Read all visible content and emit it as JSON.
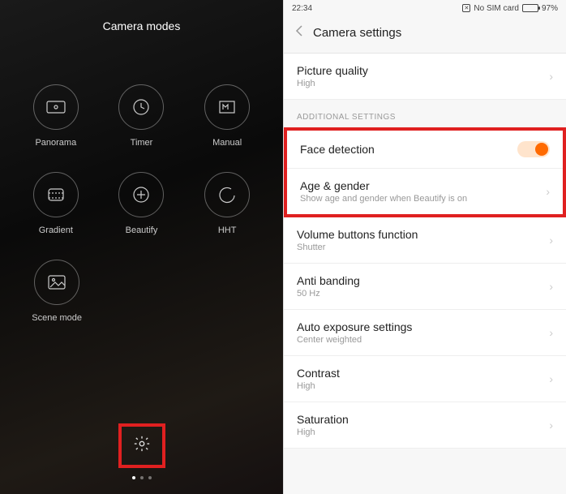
{
  "left": {
    "title": "Camera modes",
    "modes": [
      {
        "label": "Panorama",
        "icon": "panorama"
      },
      {
        "label": "Timer",
        "icon": "timer"
      },
      {
        "label": "Manual",
        "icon": "manual"
      },
      {
        "label": "Gradient",
        "icon": "gradient"
      },
      {
        "label": "Beautify",
        "icon": "beautify"
      },
      {
        "label": "HHT",
        "icon": "hht"
      },
      {
        "label": "Scene mode",
        "icon": "scene"
      }
    ]
  },
  "right": {
    "status": {
      "time": "22:34",
      "sim": "No SIM card",
      "battery_pct": "97%"
    },
    "header": "Camera settings",
    "top_rows": [
      {
        "title": "Picture quality",
        "sub": "High"
      }
    ],
    "section_label": "ADDITIONAL SETTINGS",
    "highlighted": [
      {
        "title": "Face detection",
        "toggle": true
      },
      {
        "title": "Age & gender",
        "sub": "Show age and gender when Beautify is on"
      }
    ],
    "rows": [
      {
        "title": "Volume buttons function",
        "sub": "Shutter"
      },
      {
        "title": "Anti banding",
        "sub": "50 Hz"
      },
      {
        "title": "Auto exposure settings",
        "sub": "Center weighted"
      },
      {
        "title": "Contrast",
        "sub": "High"
      },
      {
        "title": "Saturation",
        "sub": "High"
      }
    ]
  }
}
